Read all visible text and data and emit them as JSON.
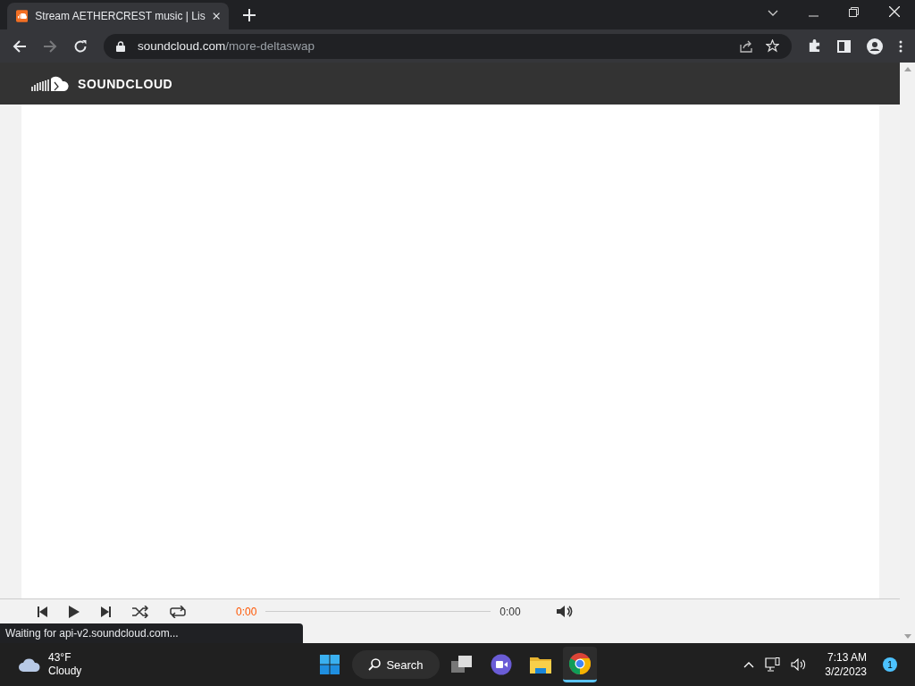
{
  "browser": {
    "tab": {
      "title": "Stream AETHERCREST music | Lis",
      "selected": true
    },
    "url_host": "soundcloud.com",
    "url_path": "/more-deltaswap"
  },
  "site": {
    "logo_text": "SOUNDCLOUD"
  },
  "player": {
    "elapsed": "0:00",
    "duration": "0:00",
    "progress": {
      "level": 0
    }
  },
  "status_bubble": "Waiting for api-v2.soundcloud.com...",
  "taskbar": {
    "weather": {
      "temp": "43°F",
      "condition": "Cloudy"
    },
    "search": "Search",
    "apps": [
      {
        "kind": "start",
        "selected": false
      },
      {
        "kind": "taskview",
        "selected": false
      },
      {
        "kind": "chat",
        "selected": false
      },
      {
        "kind": "files",
        "selected": false
      },
      {
        "kind": "chrome",
        "selected": true
      }
    ],
    "time": "7:13 AM",
    "date": "3/2/2023",
    "notifications": "1"
  }
}
